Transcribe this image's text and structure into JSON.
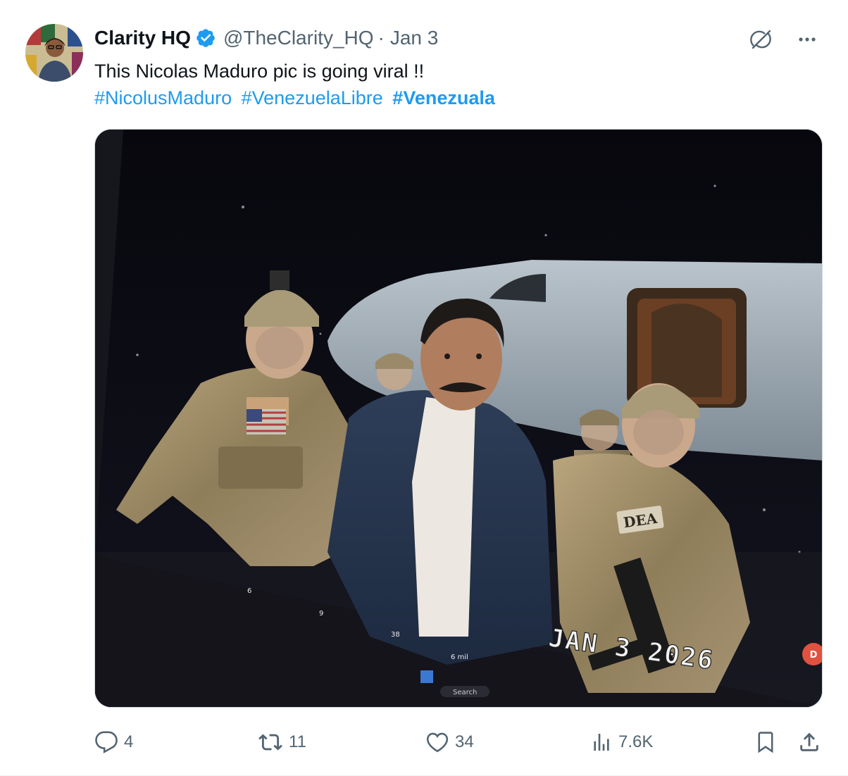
{
  "tweet": {
    "author_name": "Clarity HQ",
    "handle": "@TheClarity_HQ",
    "separator": "·",
    "time": "Jan 3",
    "text": "This Nicolas Maduro pic is going viral !!",
    "hashtags": [
      "#NicolusMaduro",
      "#VenezuelaLibre",
      "#Venezuala"
    ]
  },
  "media": {
    "overlay_text": "JAN 3 2026",
    "insignia_text": "DEA",
    "screen_badge": "D",
    "screen_counts": [
      "6",
      "9",
      "38",
      "6 mil"
    ],
    "screen_search": "Search"
  },
  "actions": {
    "replies": "4",
    "reposts": "11",
    "likes": "34",
    "views": "7.6K"
  },
  "icons": {
    "verified": "verified-badge-icon",
    "grok": "grok-icon",
    "more": "more-icon",
    "reply": "reply-icon",
    "repost": "repost-icon",
    "like": "like-icon",
    "views": "views-icon",
    "bookmark": "bookmark-icon",
    "share": "share-icon"
  },
  "colors": {
    "link": "#1d9bf0",
    "secondary": "#536471",
    "verified": "#1d9bf0"
  }
}
